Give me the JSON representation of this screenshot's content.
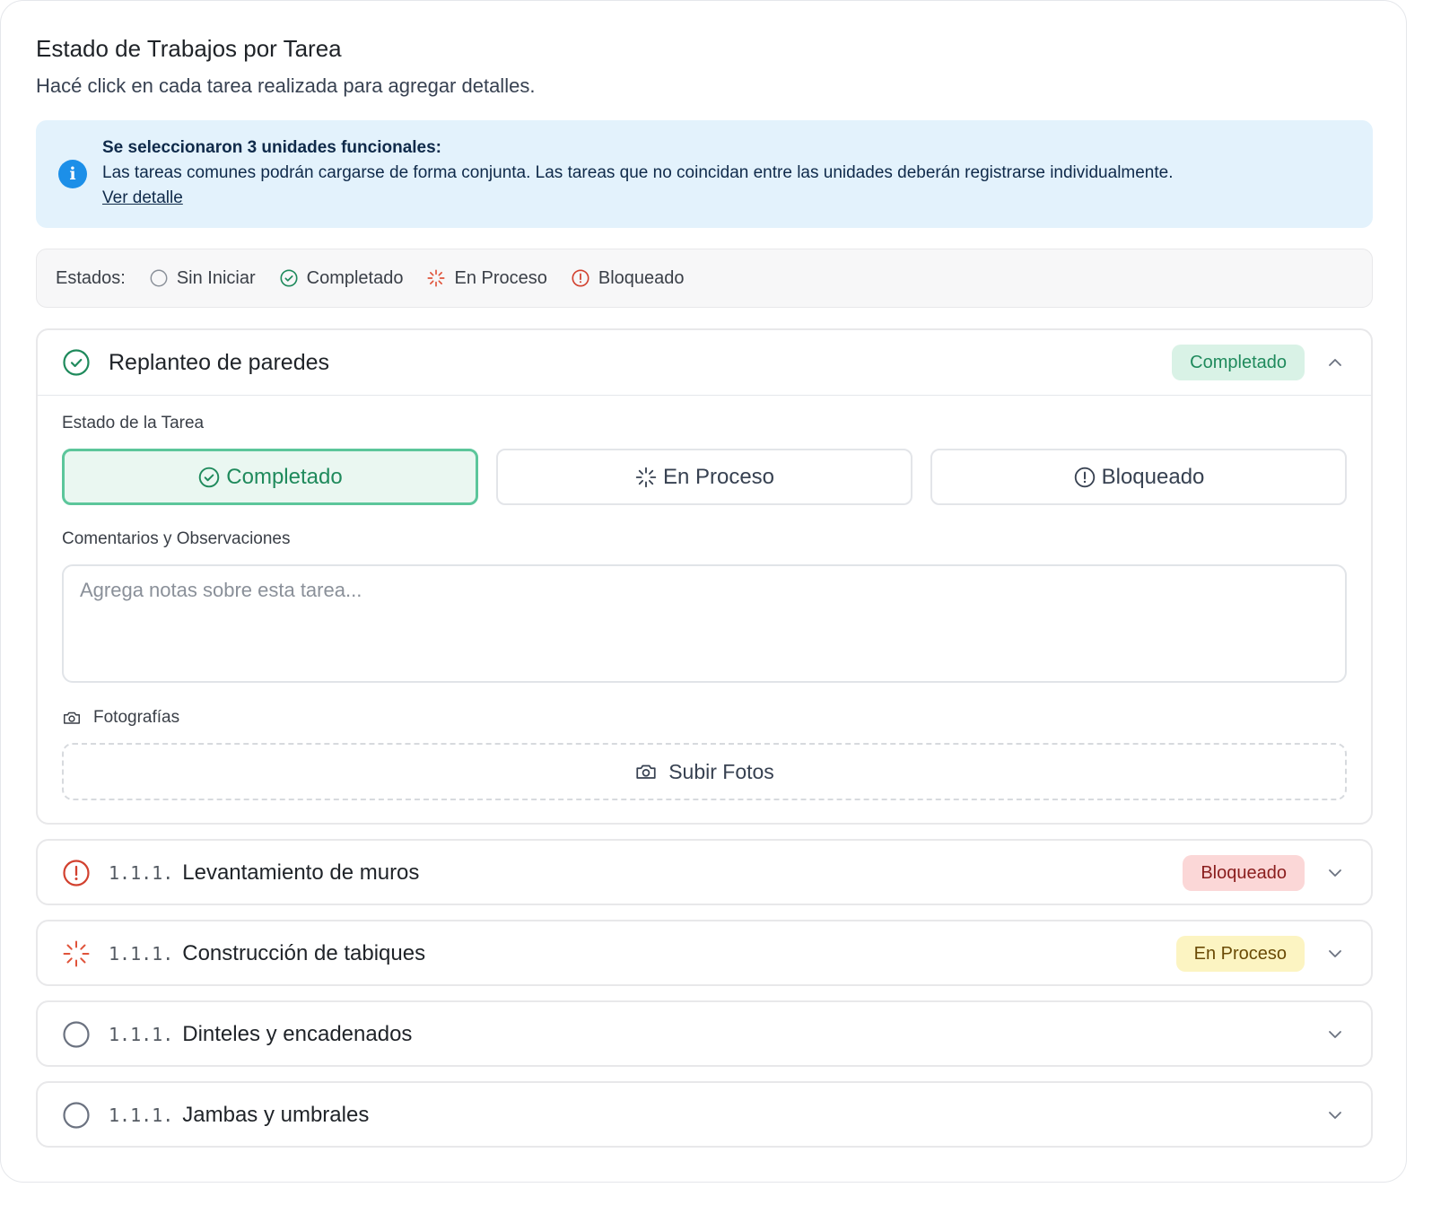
{
  "header": {
    "title": "Estado de Trabajos por Tarea",
    "subtitle": "Hacé click en cada tarea realizada para agregar detalles."
  },
  "info": {
    "title": "Se seleccionaron 3 unidades funcionales:",
    "text": "Las tareas comunes podrán cargarse de forma conjunta. Las tareas que no coincidan entre las unidades deberán registrarse individualmente.",
    "link": "Ver detalle",
    "icon": "info-icon"
  },
  "legend": {
    "label": "Estados:",
    "items": [
      {
        "label": "Sin Iniciar",
        "icon": "empty-circle-icon"
      },
      {
        "label": "Completado",
        "icon": "check-circle-icon"
      },
      {
        "label": "En Proceso",
        "icon": "spinner-icon"
      },
      {
        "label": "Bloqueado",
        "icon": "alert-circle-icon"
      }
    ]
  },
  "colors": {
    "green": "#1f8a5c",
    "red": "#d2412f",
    "orange": "#e0533a",
    "gray": "#6b7280",
    "info_bg": "#e3f2fc"
  },
  "expanded_task": {
    "title": "Replanteo de paredes",
    "badge": "Completado",
    "status_label": "Estado de la Tarea",
    "status_options": [
      {
        "label": "Completado",
        "active": true
      },
      {
        "label": "En Proceso",
        "active": false
      },
      {
        "label": "Bloqueado",
        "active": false
      }
    ],
    "comments_label": "Comentarios y Observaciones",
    "comments_value": "",
    "comments_placeholder": "Agrega notas sobre esta tarea...",
    "photos_label": "Fotografías",
    "upload_label": "Subir Fotos"
  },
  "tasks": [
    {
      "code": "1.1.1.",
      "title": "Levantamiento de muros",
      "badge": "Bloqueado",
      "status": "blocked"
    },
    {
      "code": "1.1.1.",
      "title": "Construcción de tabiques",
      "badge": "En Proceso",
      "status": "in-progress"
    },
    {
      "code": "1.1.1.",
      "title": "Dinteles y encadenados",
      "badge": "",
      "status": "not-started"
    },
    {
      "code": "1.1.1.",
      "title": "Jambas y umbrales",
      "badge": "",
      "status": "not-started"
    }
  ]
}
